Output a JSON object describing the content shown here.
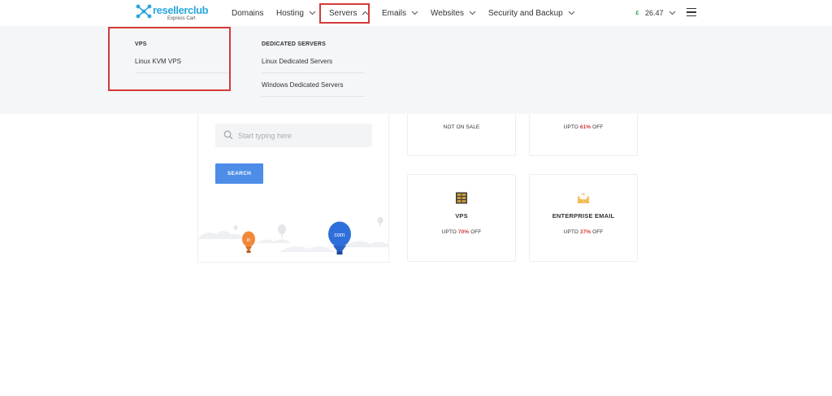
{
  "brand": {
    "name": "resellerclub",
    "tagline": "Express Cart"
  },
  "nav": {
    "items": [
      {
        "label": "Domains"
      },
      {
        "label": "Hosting"
      },
      {
        "label": "Servers"
      },
      {
        "label": "Emails"
      },
      {
        "label": "Websites"
      },
      {
        "label": "Security and Backup"
      }
    ],
    "balance": {
      "currency_symbol": "£",
      "amount": "26.47"
    }
  },
  "dropdown": {
    "vps": {
      "title": "VPS",
      "links": [
        "Linux KVM VPS"
      ]
    },
    "dedicated": {
      "title": "DEDICATED SERVERS",
      "links": [
        "Linux Dedicated Servers",
        "Windows Dedicated Servers"
      ]
    }
  },
  "search": {
    "placeholder": "Start typing here",
    "value": "",
    "button_label": "SEARCH"
  },
  "balloon_labels": [
    "in",
    "com"
  ],
  "cards": {
    "top_left": {
      "offer": "NOT ON SALE"
    },
    "top_right": {
      "offer_prefix": "UPTO",
      "discount": "61%",
      "offer_suffix": "OFF"
    },
    "vps": {
      "title": "VPS",
      "offer_prefix": "UPTO",
      "discount": "70%",
      "offer_suffix": "OFF",
      "icon": "server-rack-icon"
    },
    "email": {
      "title": "ENTERPRISE EMAIL",
      "offer_prefix": "UPTO",
      "discount": "37%",
      "offer_suffix": "OFF",
      "icon": "envelope-icon"
    }
  },
  "colors": {
    "accent_blue": "#4d8de8",
    "highlight_red": "#d43a3a",
    "discount_red": "#d43a3a",
    "logo_blue": "#2aa7de",
    "balance_green": "#1e9e55"
  }
}
